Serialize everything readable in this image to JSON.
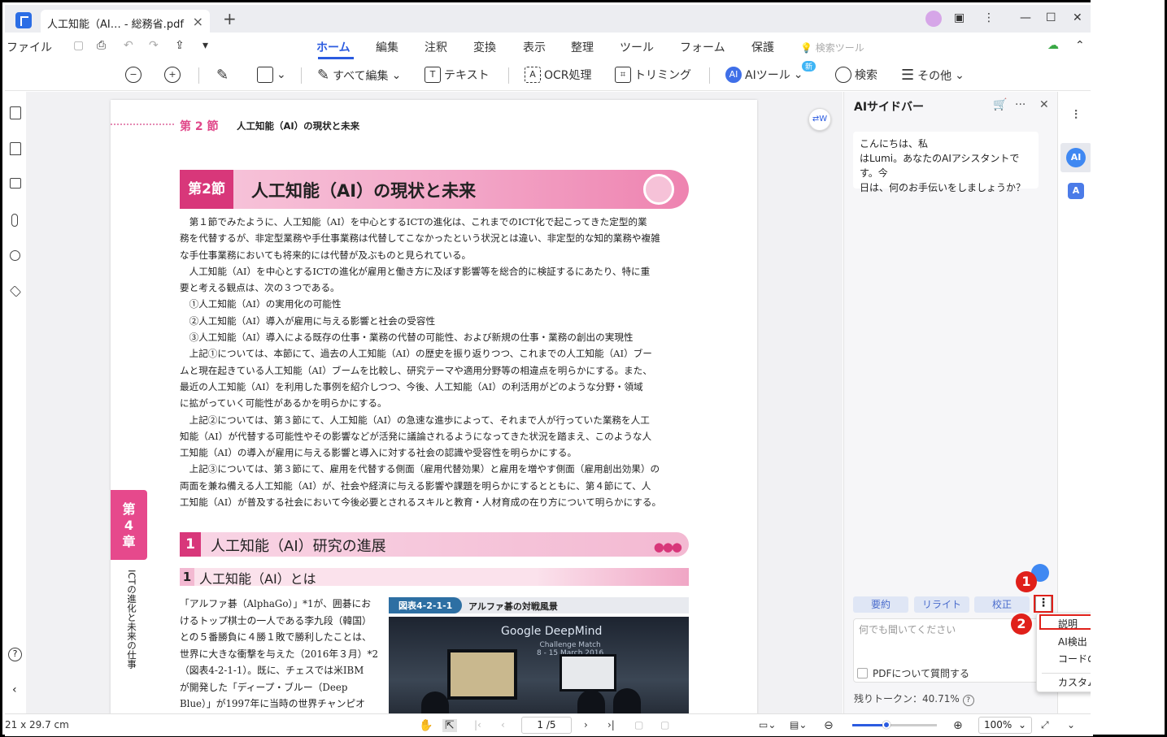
{
  "titlebar": {
    "tab_title": "人工知能（AI… - 総務省.pdf",
    "close": "×",
    "newtab": "+",
    "win_min": "—",
    "win_max": "☐",
    "win_close": "✕"
  },
  "menu": {
    "file": "ファイル",
    "items": [
      "ホーム",
      "編集",
      "注釈",
      "変換",
      "表示",
      "整理",
      "ツール",
      "フォーム",
      "保護"
    ],
    "search_tool": "検索ツール"
  },
  "toolbar": {
    "edit_all": "すべて編集",
    "text": "テキスト",
    "ocr": "OCR処理",
    "trim": "トリミング",
    "ai_tools": "AIツール",
    "new_badge": "新",
    "search": "検索",
    "other": "その他"
  },
  "page": {
    "sec_label": "第 2 節",
    "sec_sub": "人工知能（AI）の現状と未来",
    "banner_badge": "第2節",
    "banner_title": "人工知能（AI）の現状と未来",
    "para1": "　第１節でみたように、人工知能（AI）を中心とするICTの進化は、これまでのICT化で起こってきた定型的業\n務を代替するが、非定型業務や手仕事業務は代替してこなかったという状況とは違い、非定型的な知的業務や複雑\nな手仕事業務においても将来的には代替が及ぶものと見られている。\n　人工知能（AI）を中心とするICTの進化が雇用と働き方に及ぼす影響等を総合的に検証するにあたり、特に重\n要と考える観点は、次の３つである。\n　①人工知能（AI）の実用化の可能性\n　②人工知能（AI）導入が雇用に与える影響と社会の受容性\n　③人工知能（AI）導入による既存の仕事・業務の代替の可能性、および新規の仕事・業務の創出の実現性\n　上記①については、本節にて、過去の人工知能（AI）の歴史を振り返りつつ、これまでの人工知能（AI）ブー\nムと現在起きている人工知能（AI）ブームを比較し、研究テーマや適用分野等の相違点を明らかにする。また、\n最近の人工知能（AI）を利用した事例を紹介しつつ、今後、人工知能（AI）の利活用がどのような分野・領域\nに拡がっていく可能性があるかを明らかにする。\n　上記②については、第３節にて、人工知能（AI）の急速な進歩によって、それまで人が行っていた業務を人工\n知能（AI）が代替する可能性やその影響などが活発に議論されるようになってきた状況を踏まえ、このような人\n工知能（AI）の導入が雇用に与える影響と導入に対する社会の認識や受容性を明らかにする。\n　上記③については、第３節にて、雇用を代替する側面（雇用代替効果）と雇用を増やす側面（雇用創出効果）の\n両面を兼ね備える人工知能（AI）が、社会や経済に与える影響や課題を明らかにするとともに、第４節にて、人\n工知能（AI）が普及する社会において今後必要とされるスキルと教育・人材育成の在り方について明らかにする。",
    "side_badge": "第\n4\n章",
    "side_text": "ICTの進化と未来の仕事",
    "h1_num": "1",
    "h1_title": "人工知能（AI）研究の進展",
    "h1_dots": "●●●",
    "h2_num": "1",
    "h2_title": "人工知能（AI）とは",
    "left_col": "「アルファ碁（AlphaGo）」*1が、囲碁にお\nけるトップ棋士の一人である李九段（韓国）\nとの５番勝負に４勝１敗で勝利したことは、\n世界に大きな衝撃を与えた（2016年３月）*2\n（図表4-2-1-1）。既に、チェスでは米IBM\nが開発した「ディープ・ブルー（Deep\nBlue）」が1997年に当時の世界チャンピオ",
    "fig_label": "図表4-2-1-1",
    "fig_caption": "アルファ碁の対戦風景",
    "photo_line1": "Google DeepMind",
    "photo_line2": "Challenge Match\n8 - 15 March 2016"
  },
  "aipanel": {
    "title": "AIサイドバー",
    "greeting": "こんにちは、私\nはLumi。あなたのAIアシスタントです。今\n日は、何のお手伝いをしましょうか？",
    "chips": [
      "要約",
      "リライト",
      "校正"
    ],
    "more": "⋮",
    "input_placeholder": "何でも聞いてください",
    "pdf_check": "PDFについて質問する",
    "tokens": "残りトークン：40.71%"
  },
  "dropdown": {
    "items": [
      "説明",
      "AI検出",
      "コードの説明",
      "カスタム"
    ]
  },
  "steps": [
    "1",
    "2"
  ],
  "statusbar": {
    "size": "21 x 29.7 cm",
    "page": "1 /5",
    "zoom": "100%"
  },
  "colors": {
    "accent": "#2b5be0",
    "pink": "#d8377a",
    "red": "#e0201a"
  }
}
